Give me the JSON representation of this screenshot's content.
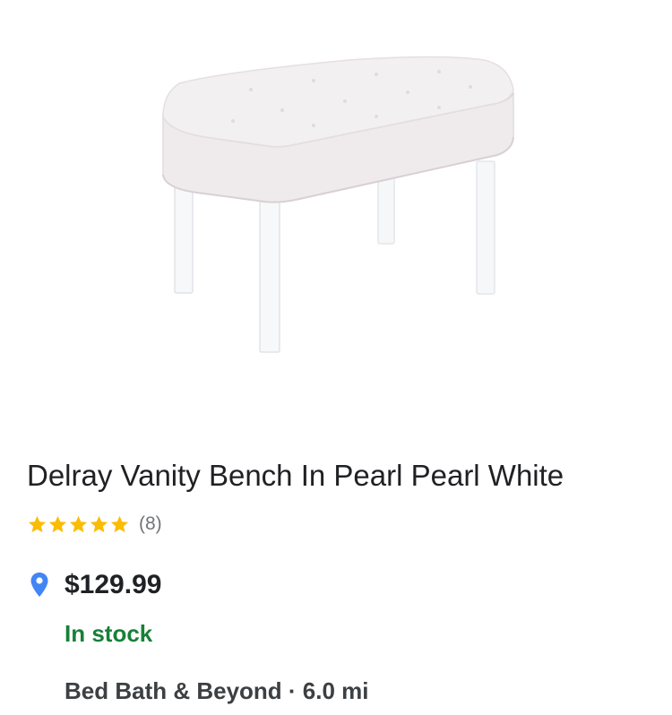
{
  "product": {
    "title": "Delray Vanity Bench In Pearl Pearl White",
    "image_alt": "bench-product-image",
    "rating": {
      "stars": 5,
      "max_stars": 5,
      "count_text": "(8)",
      "star_color": "#fbbc04"
    },
    "price": "$129.99",
    "availability": "In stock",
    "availability_color": "#188038",
    "store": {
      "name": "Bed Bath & Beyond",
      "separator": " · ",
      "distance": "6.0 mi"
    },
    "location_icon": "map-pin-icon",
    "location_icon_color": "#4285f4"
  }
}
